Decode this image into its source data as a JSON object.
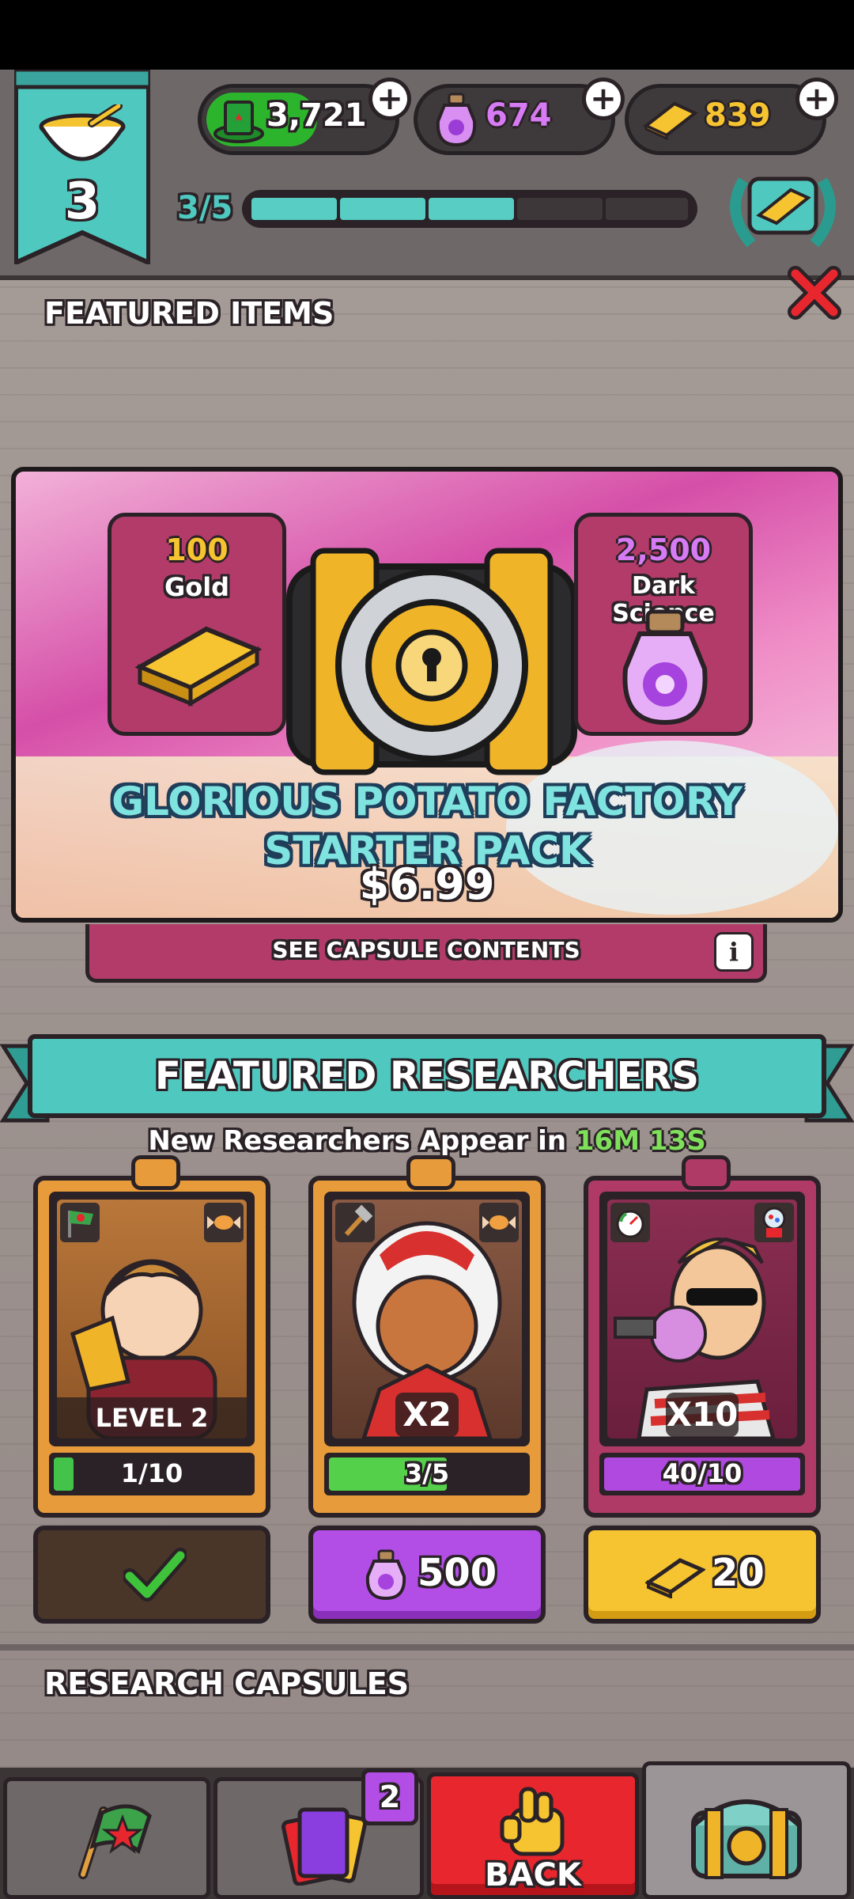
{
  "hud": {
    "level": "3",
    "progress_text": "3/5",
    "progress_fraction": 0.6,
    "currencies": [
      {
        "name": "cash",
        "value": "3,721",
        "icon": "green-hat-icon"
      },
      {
        "name": "dark_science",
        "value": "674",
        "icon": "potion-jar-icon"
      },
      {
        "name": "gold",
        "value": "839",
        "icon": "gold-bar-icon"
      }
    ]
  },
  "featured_items": {
    "section_title": "FEATURED ITEMS",
    "pack": {
      "title_line1": "GLORIOUS POTATO FACTORY",
      "title_line2": "STARTER PACK",
      "price": "$6.99",
      "gold_amount": "100",
      "gold_label": "Gold",
      "ds_amount": "2,500",
      "ds_label": "Dark Science",
      "see_contents": "SEE CAPSULE CONTENTS"
    }
  },
  "featured_researchers": {
    "title": "FEATURED RESEARCHERS",
    "timer_prefix": "New Researchers Appear in",
    "timer_value": "16M 13S",
    "cards": [
      {
        "badge": "LEVEL 2",
        "progress": "1/10",
        "progress_fraction": 0.1,
        "bar_color": "#43c34a",
        "frame": "#e89b3a",
        "action": "owned",
        "price": ""
      },
      {
        "badge": "X2",
        "progress": "3/5",
        "progress_fraction": 0.6,
        "bar_color": "#55d04b",
        "frame": "#e89b3a",
        "action": "dark_science",
        "price": "500"
      },
      {
        "badge": "X10",
        "progress": "40/10",
        "progress_fraction": 1.0,
        "bar_color": "#b049e0",
        "frame": "#b03a66",
        "action": "gold",
        "price": "20"
      }
    ]
  },
  "research_capsules": {
    "title": "RESEARCH CAPSULES"
  },
  "bottom_nav": {
    "cards_badge": "2",
    "back_label": "BACK"
  },
  "colors": {
    "teal": "#4fc9c0",
    "magenta": "#b23b6a",
    "purple": "#b24ee6",
    "yellow": "#f5c430",
    "red": "#e8262e"
  }
}
